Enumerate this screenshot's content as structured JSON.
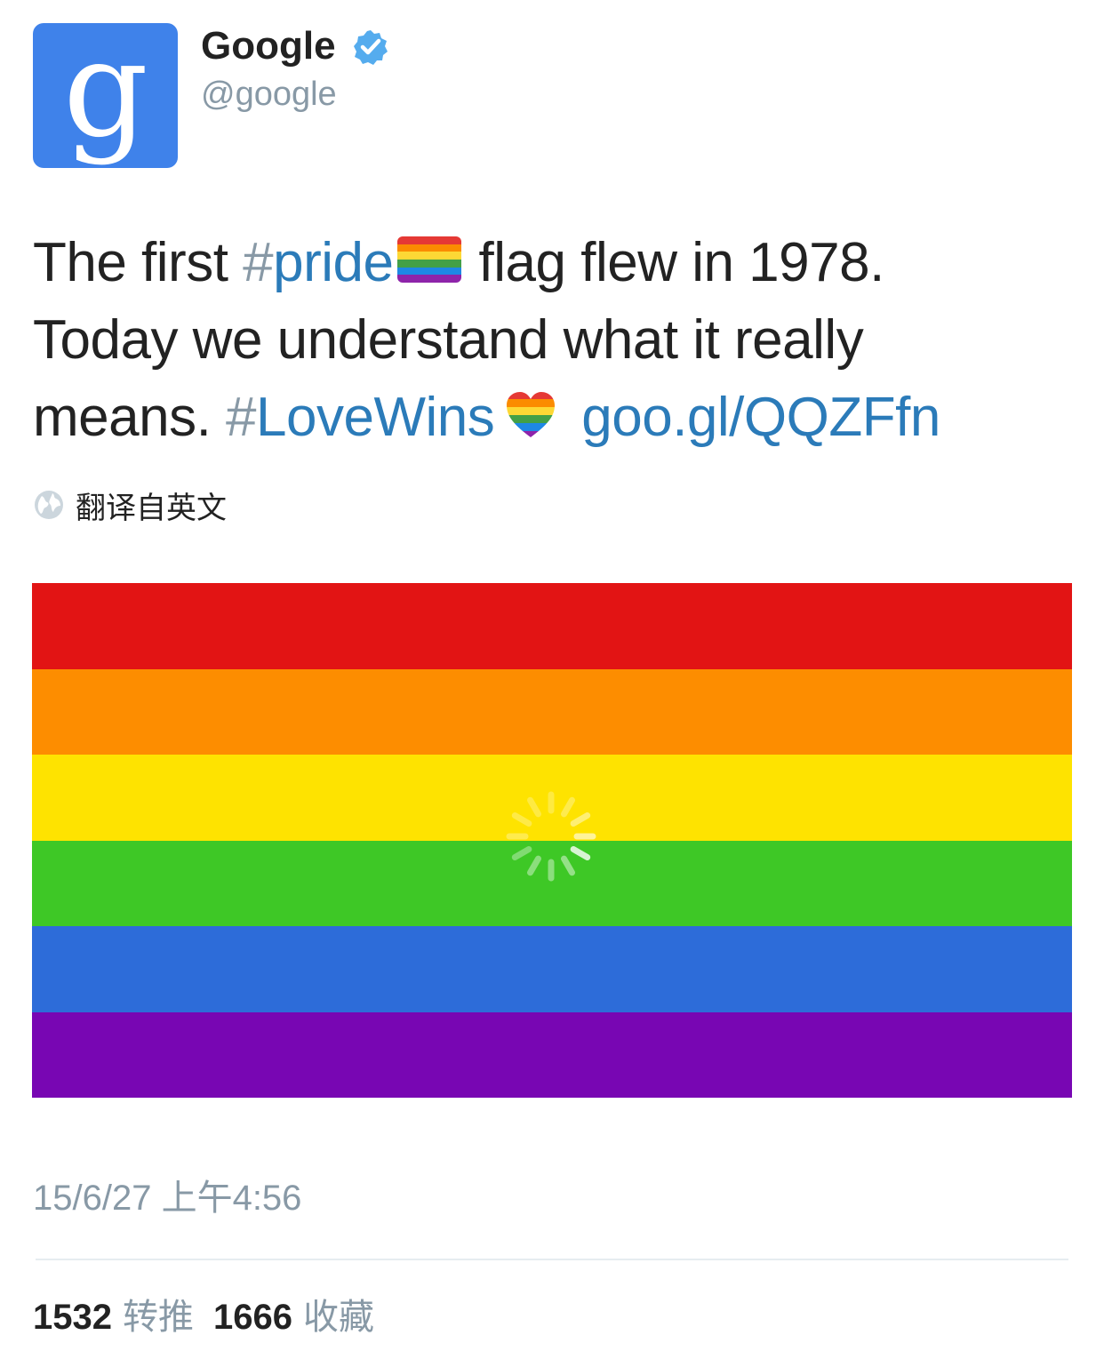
{
  "author": {
    "display_name": "Google",
    "handle": "@google",
    "avatar_letter": "g",
    "avatar_color": "#3f82ea",
    "verified_icon": "verified-badge-icon",
    "verified_color": "#55acee"
  },
  "tweet": {
    "line1_prefix": "The first ",
    "hashtag1_symbol": "#",
    "hashtag1_text": "pride",
    "line1_suffix": "flag flew in 1978.",
    "line2": "Today we understand what it really",
    "line3_prefix": "means. ",
    "hashtag2_symbol": "#",
    "hashtag2_text": "LoveWins",
    "link": "goo.gl/QQZFfn",
    "hashtag_color": "#2b7bb9",
    "link_color": "#2b7bb9"
  },
  "translate": {
    "icon": "globe-icon",
    "label": "翻译自英文"
  },
  "media": {
    "description_icon": "loading-spinner-icon",
    "stripe_colors": [
      "#e21414",
      "#fd8d00",
      "#fee300",
      "#3ec826",
      "#2d6cd9",
      "#7806b3"
    ]
  },
  "meta": {
    "timestamp": "15/6/27 上午4:56"
  },
  "stats": {
    "retweets_count": "1532",
    "retweets_label": "转推",
    "favorites_count": "1666",
    "favorites_label": "收藏"
  }
}
